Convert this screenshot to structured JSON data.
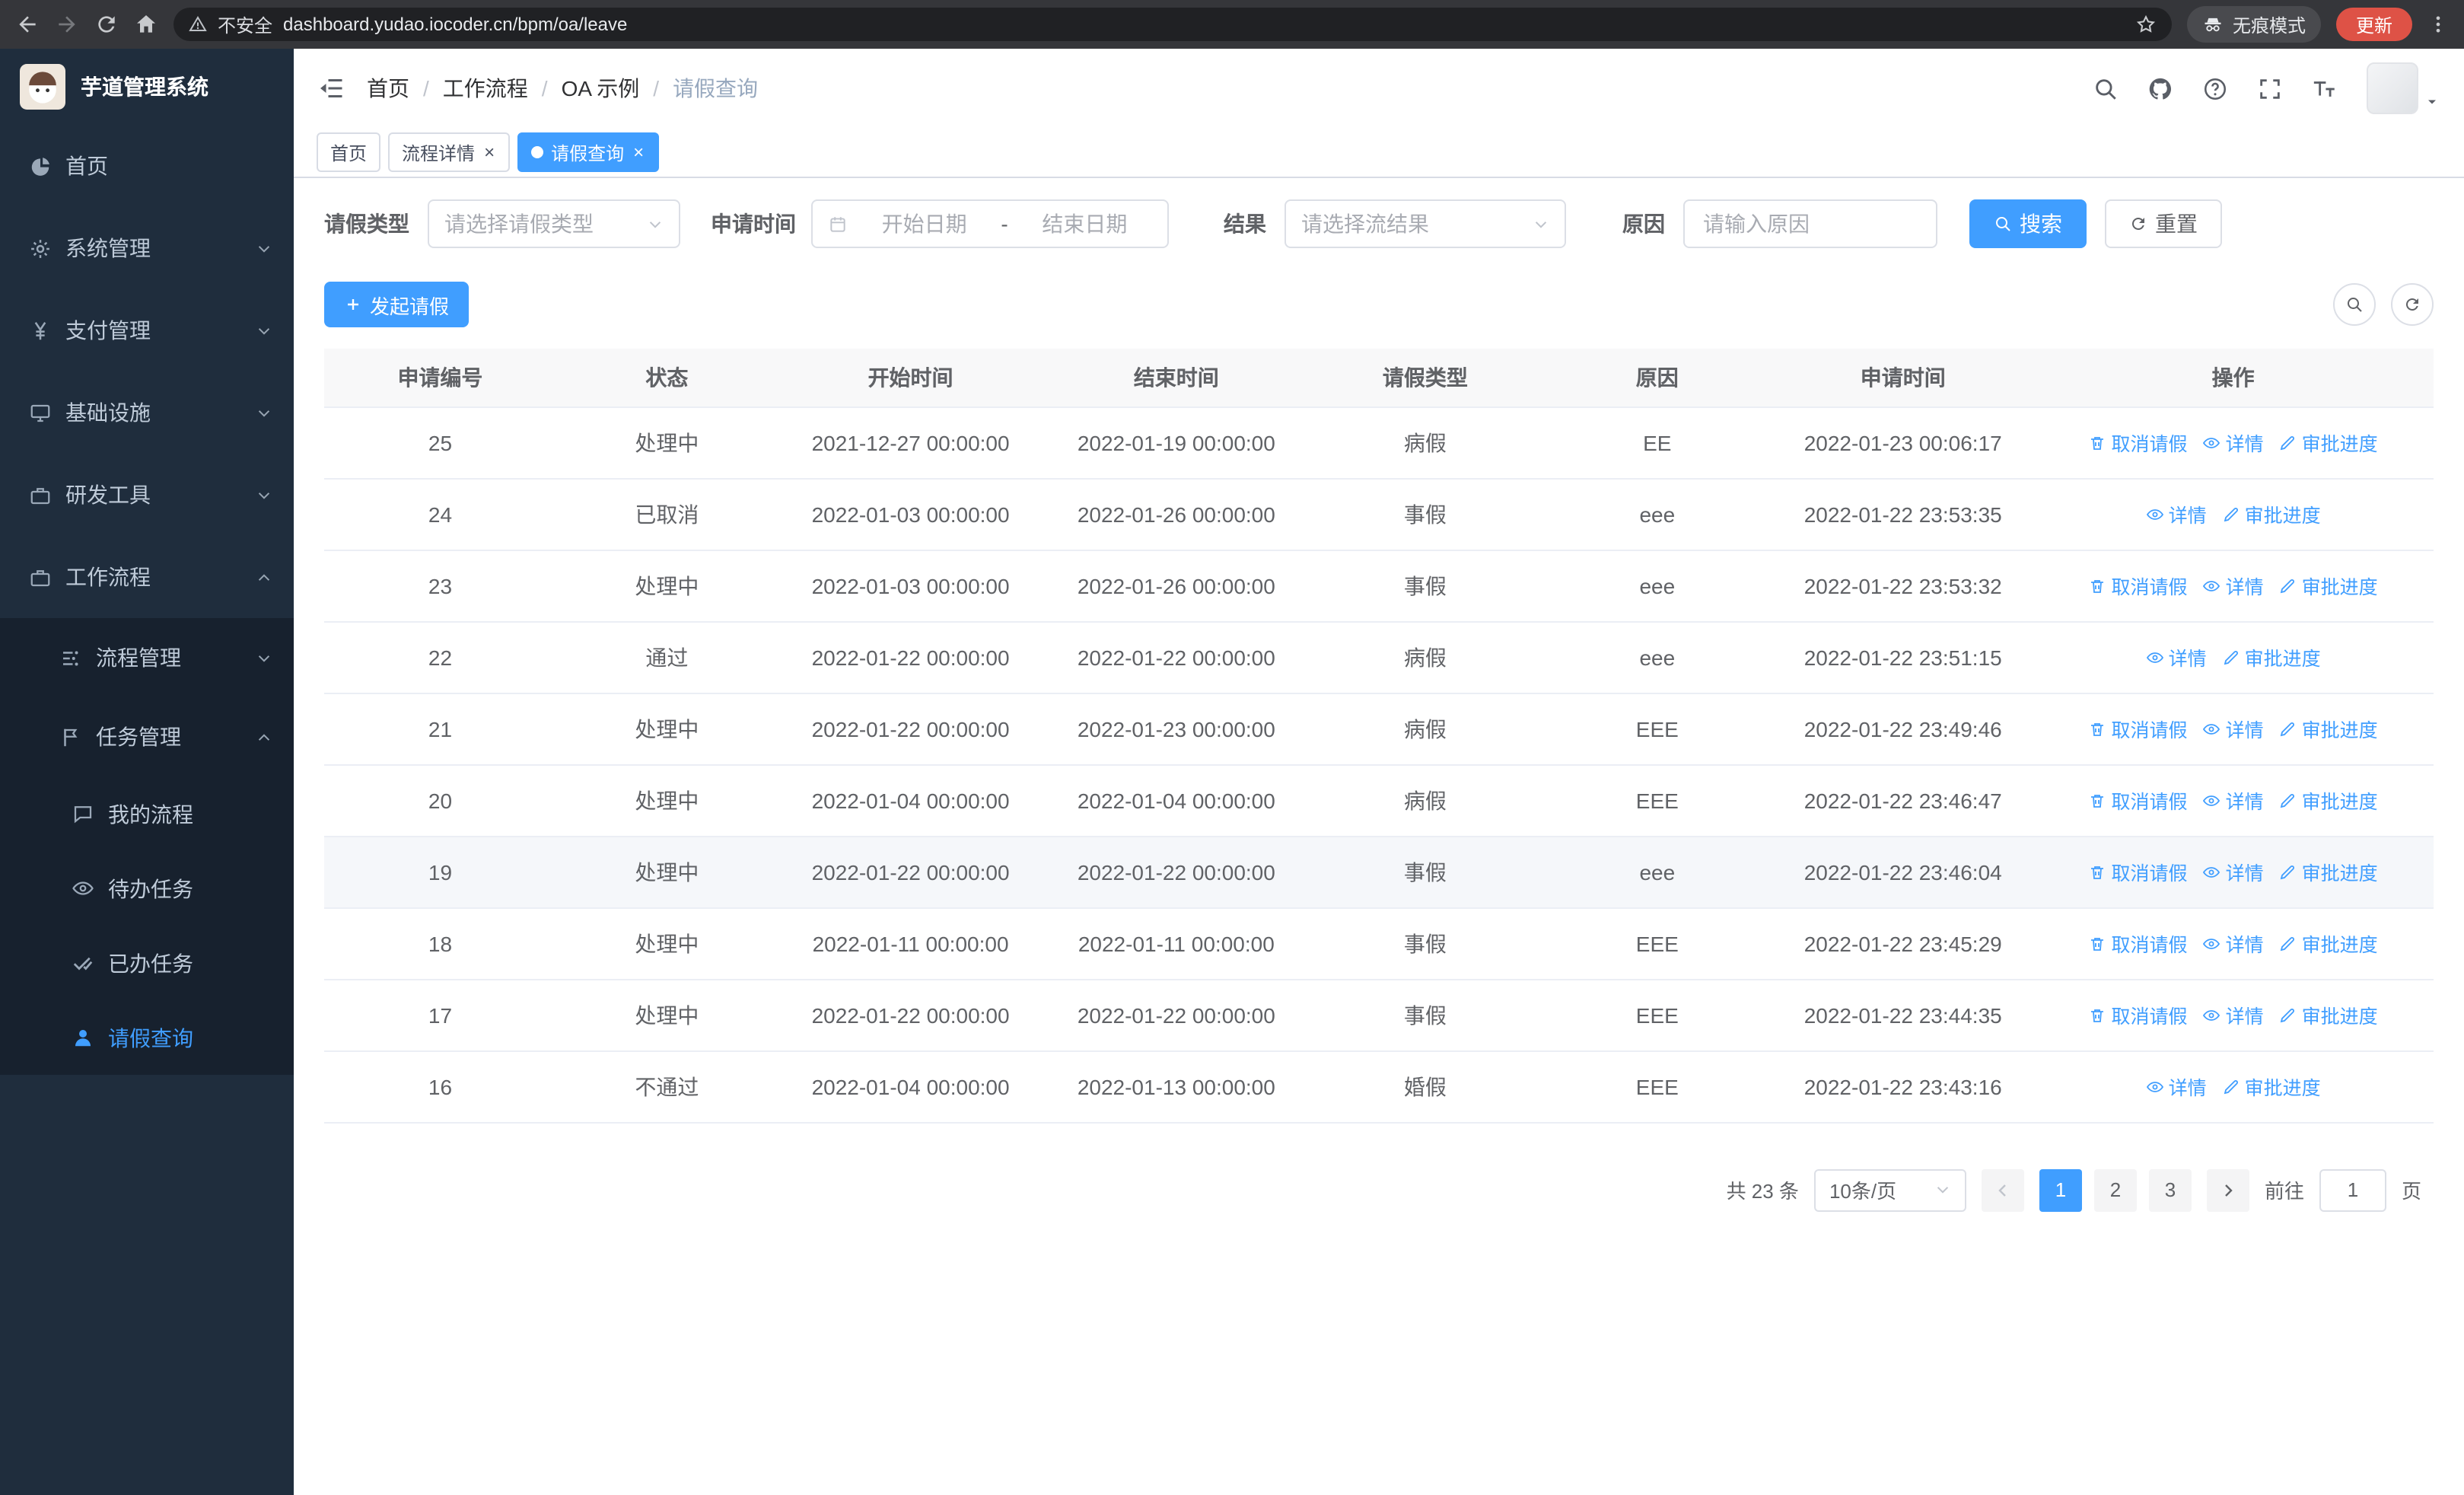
{
  "browser": {
    "security_label": "不安全",
    "url": "dashboard.yudao.iocoder.cn/bpm/oa/leave",
    "incognito_label": "无痕模式",
    "update_label": "更新"
  },
  "sidebar": {
    "app_title": "芋道管理系统",
    "items": [
      {
        "label": "首页"
      },
      {
        "label": "系统管理"
      },
      {
        "label": "支付管理"
      },
      {
        "label": "基础设施"
      },
      {
        "label": "研发工具"
      },
      {
        "label": "工作流程"
      },
      {
        "label": "流程管理"
      },
      {
        "label": "任务管理"
      },
      {
        "label": "我的流程"
      },
      {
        "label": "待办任务"
      },
      {
        "label": "已办任务"
      },
      {
        "label": "请假查询"
      }
    ]
  },
  "header": {
    "breadcrumb": {
      "items": [
        "首页",
        "工作流程",
        "OA 示例",
        "请假查询"
      ],
      "separator": "/"
    }
  },
  "tags": {
    "close_glyph": "×",
    "tabs": [
      {
        "label": "首页"
      },
      {
        "label": "流程详情"
      },
      {
        "label": "请假查询"
      }
    ]
  },
  "filters": {
    "leave_type_label": "请假类型",
    "leave_type_placeholder": "请选择请假类型",
    "time_label": "申请时间",
    "start_placeholder": "开始日期",
    "range_separator": "-",
    "end_placeholder": "结束日期",
    "result_label": "结果",
    "result_placeholder": "请选择流结果",
    "reason_label": "原因",
    "reason_placeholder": "请输入原因",
    "search_label": "搜索",
    "reset_label": "重置"
  },
  "toolbar": {
    "create_label": "发起请假"
  },
  "table": {
    "columns": [
      "申请编号",
      "状态",
      "开始时间",
      "结束时间",
      "请假类型",
      "原因",
      "申请时间",
      "操作"
    ],
    "action_labels": {
      "cancel": "取消请假",
      "detail": "详情",
      "progress": "审批进度"
    },
    "rows": [
      {
        "id": "25",
        "status": "处理中",
        "start": "2021-12-27 00:00:00",
        "end": "2022-01-19 00:00:00",
        "type": "病假",
        "reason": "EE",
        "apply": "2022-01-23 00:06:17",
        "actions": [
          "cancel",
          "detail",
          "progress"
        ]
      },
      {
        "id": "24",
        "status": "已取消",
        "start": "2022-01-03 00:00:00",
        "end": "2022-01-26 00:00:00",
        "type": "事假",
        "reason": "eee",
        "apply": "2022-01-22 23:53:35",
        "actions": [
          "detail",
          "progress"
        ]
      },
      {
        "id": "23",
        "status": "处理中",
        "start": "2022-01-03 00:00:00",
        "end": "2022-01-26 00:00:00",
        "type": "事假",
        "reason": "eee",
        "apply": "2022-01-22 23:53:32",
        "actions": [
          "cancel",
          "detail",
          "progress"
        ]
      },
      {
        "id": "22",
        "status": "通过",
        "start": "2022-01-22 00:00:00",
        "end": "2022-01-22 00:00:00",
        "type": "病假",
        "reason": "eee",
        "apply": "2022-01-22 23:51:15",
        "actions": [
          "detail",
          "progress"
        ]
      },
      {
        "id": "21",
        "status": "处理中",
        "start": "2022-01-22 00:00:00",
        "end": "2022-01-23 00:00:00",
        "type": "病假",
        "reason": "EEE",
        "apply": "2022-01-22 23:49:46",
        "actions": [
          "cancel",
          "detail",
          "progress"
        ]
      },
      {
        "id": "20",
        "status": "处理中",
        "start": "2022-01-04 00:00:00",
        "end": "2022-01-04 00:00:00",
        "type": "病假",
        "reason": "EEE",
        "apply": "2022-01-22 23:46:47",
        "actions": [
          "cancel",
          "detail",
          "progress"
        ]
      },
      {
        "id": "19",
        "status": "处理中",
        "start": "2022-01-22 00:00:00",
        "end": "2022-01-22 00:00:00",
        "type": "事假",
        "reason": "eee",
        "apply": "2022-01-22 23:46:04",
        "actions": [
          "cancel",
          "detail",
          "progress"
        ],
        "highlighted": true
      },
      {
        "id": "18",
        "status": "处理中",
        "start": "2022-01-11 00:00:00",
        "end": "2022-01-11 00:00:00",
        "type": "事假",
        "reason": "EEE",
        "apply": "2022-01-22 23:45:29",
        "actions": [
          "cancel",
          "detail",
          "progress"
        ]
      },
      {
        "id": "17",
        "status": "处理中",
        "start": "2022-01-22 00:00:00",
        "end": "2022-01-22 00:00:00",
        "type": "事假",
        "reason": "EEE",
        "apply": "2022-01-22 23:44:35",
        "actions": [
          "cancel",
          "detail",
          "progress"
        ]
      },
      {
        "id": "16",
        "status": "不通过",
        "start": "2022-01-04 00:00:00",
        "end": "2022-01-13 00:00:00",
        "type": "婚假",
        "reason": "EEE",
        "apply": "2022-01-22 23:43:16",
        "actions": [
          "detail",
          "progress"
        ]
      }
    ]
  },
  "pagination": {
    "total_label": "共 23 条",
    "page_size_label": "10条/页",
    "pages": [
      "1",
      "2",
      "3"
    ],
    "active_page": "1",
    "goto_label": "前往",
    "goto_value": "1",
    "unit_label": "页"
  },
  "colors": {
    "primary": "#409eff",
    "sidebar_bg": "#1f2d3d",
    "update_pill": "#de5246"
  }
}
